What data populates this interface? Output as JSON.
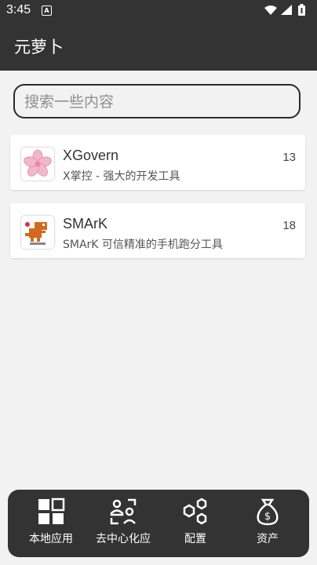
{
  "status_bar": {
    "time": "3:45",
    "notification_icon": "A"
  },
  "app_bar": {
    "title": "元萝卜"
  },
  "search": {
    "placeholder": "搜索一些内容"
  },
  "apps": [
    {
      "name": "XGovern",
      "description": "X掌控 - 强大的开发工具",
      "count": "13",
      "icon": "sakura-flower-icon"
    },
    {
      "name": "SMArK",
      "description": "SMArK 可信精准的手机跑分工具",
      "count": "18",
      "icon": "dinosaur-icon"
    }
  ],
  "bottom_nav": [
    {
      "label": "本地应用",
      "icon": "grid-icon"
    },
    {
      "label": "去中心化应",
      "icon": "people-icon"
    },
    {
      "label": "配置",
      "icon": "hexagons-icon"
    },
    {
      "label": "资产",
      "icon": "money-bag-icon"
    }
  ],
  "colors": {
    "bar": "#333333",
    "background": "#f2f2f2",
    "card": "#ffffff"
  }
}
